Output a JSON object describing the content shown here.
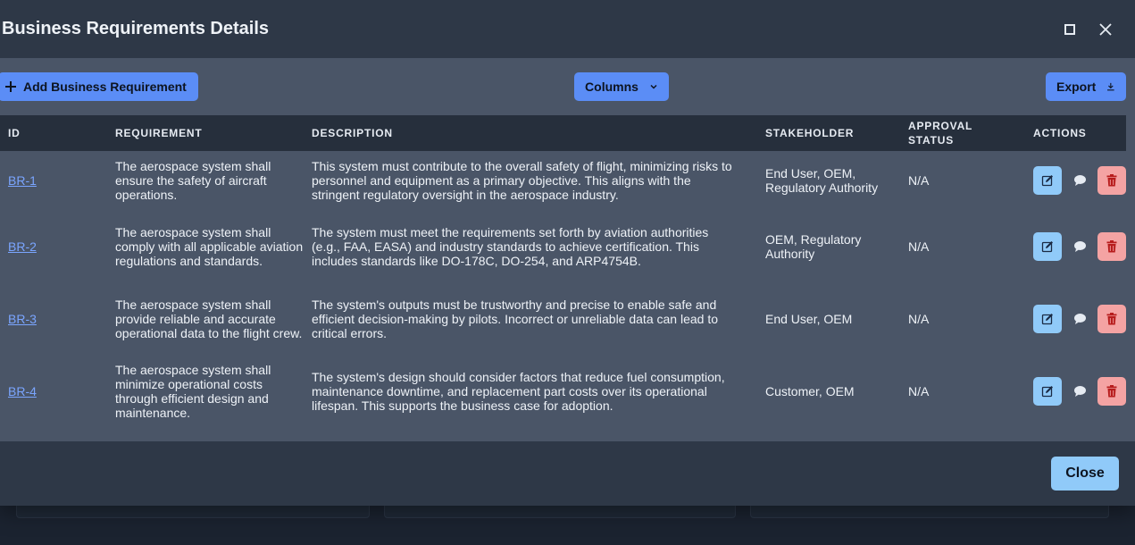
{
  "modal": {
    "title": "Business Requirements Details"
  },
  "toolbar": {
    "add_label": "Add Business Requirement",
    "columns_label": "Columns",
    "export_label": "Export"
  },
  "table": {
    "headers": {
      "id": "ID",
      "requirement": "REQUIREMENT",
      "description": "DESCRIPTION",
      "stakeholder": "STAKEHOLDER",
      "approval_status": "APPROVAL STATUS",
      "actions": "ACTIONS"
    },
    "rows": [
      {
        "id": "BR-1",
        "requirement": "The aerospace system shall ensure the safety of aircraft operations.",
        "description": "This system must contribute to the overall safety of flight, minimizing risks to personnel and equipment as a primary objective. This aligns with the stringent regulatory oversight in the aerospace industry.",
        "stakeholder": "End User, OEM, Regulatory Authority",
        "approval_status": "N/A"
      },
      {
        "id": "BR-2",
        "requirement": "The aerospace system shall comply with all applicable aviation regulations and standards.",
        "description": "The system must meet the requirements set forth by aviation authorities (e.g., FAA, EASA) and industry standards to achieve certification. This includes standards like DO-178C, DO-254, and ARP4754B.",
        "stakeholder": "OEM, Regulatory Authority",
        "approval_status": "N/A"
      },
      {
        "id": "BR-3",
        "requirement": "The aerospace system shall provide reliable and accurate operational data to the flight crew.",
        "description": "The system's outputs must be trustworthy and precise to enable safe and efficient decision-making by pilots. Incorrect or unreliable data can lead to critical errors.",
        "stakeholder": "End User, OEM",
        "approval_status": "N/A"
      },
      {
        "id": "BR-4",
        "requirement": "The aerospace system shall minimize operational costs through efficient design and maintenance.",
        "description": "The system's design should consider factors that reduce fuel consumption, maintenance downtime, and replacement part costs over its operational lifespan. This supports the business case for adoption.",
        "stakeholder": "Customer, OEM",
        "approval_status": "N/A"
      }
    ]
  },
  "footer": {
    "close_label": "Close"
  },
  "colors": {
    "accent": "#5b8df6",
    "edit": "#90caf9",
    "delete": "#f4a3a3",
    "delete_icon": "#b71c1c"
  },
  "icons": {
    "add": "plus-icon",
    "columns": "chevron-down-icon",
    "export": "download-icon",
    "maximize": "maximize-icon",
    "close": "close-icon",
    "edit": "edit-icon",
    "comment": "comment-icon",
    "delete": "trash-icon"
  }
}
